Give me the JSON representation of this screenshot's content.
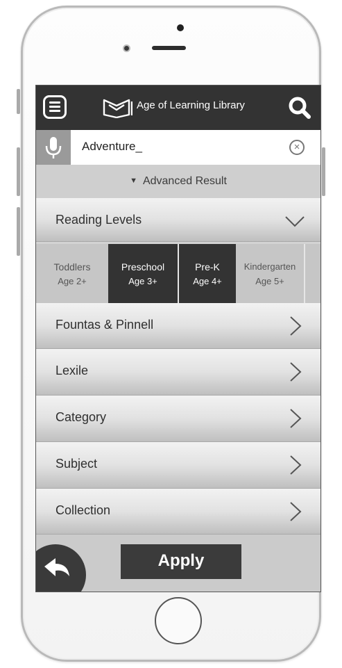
{
  "header": {
    "title": "Age of Learning Library"
  },
  "search": {
    "query": "Adventure_"
  },
  "advanced": {
    "label": "Advanced Result"
  },
  "reading_levels": {
    "label": "Reading Levels",
    "levels": [
      {
        "name": "Toddlers",
        "age": "Age 2+",
        "selected": false
      },
      {
        "name": "Preschool",
        "age": "Age 3+",
        "selected": true
      },
      {
        "name": "Pre-K",
        "age": "Age 4+",
        "selected": true
      },
      {
        "name": "Kindergarten",
        "age": "Age 5+",
        "selected": false
      }
    ]
  },
  "filters": [
    {
      "label": "Fountas & Pinnell"
    },
    {
      "label": "Lexile"
    },
    {
      "label": "Category"
    },
    {
      "label": "Subject"
    },
    {
      "label": "Collection"
    }
  ],
  "actions": {
    "apply_label": "Apply"
  },
  "colors": {
    "dark": "#333333",
    "screen_bg": "#d3d3d3",
    "selected_level": "#333333"
  },
  "icons": {
    "menu": "menu-icon",
    "logo": "book-logo-icon",
    "search": "search-icon",
    "mic": "mic-icon",
    "clear": "clear-icon",
    "expand": "chevron-down-icon",
    "forward": "chevron-right-icon",
    "back": "back-arrow-icon"
  }
}
